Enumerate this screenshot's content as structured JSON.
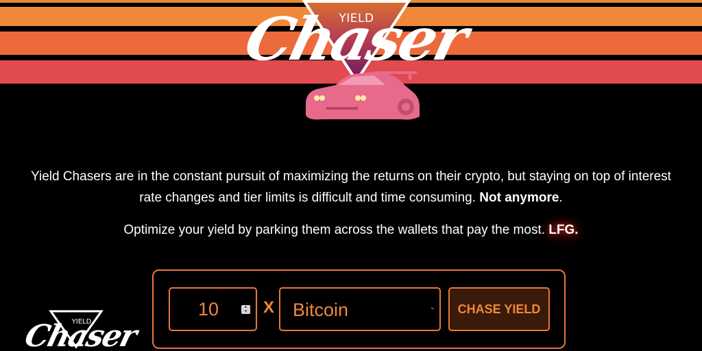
{
  "brand": {
    "logo_small_text": "YIELD",
    "logo_script_text": "Chaser",
    "colors": {
      "stripe_top": "#f0883a",
      "stripe_mid": "#ec6a3c",
      "stripe_bottom": "#e14a4e",
      "accent": "#e8793a",
      "car": "#e76a8a"
    },
    "icon": "sports-car-icon"
  },
  "intro": {
    "line1_text": "Yield Chasers are in the constant pursuit of maximizing the returns on their crypto, but staying on top of interest rate changes and tier limits is difficult and time consuming. ",
    "line1_bold": "Not anymore",
    "line1_end": ".",
    "line2_text": "Optimize your yield by parking them across the wallets that pay the most. ",
    "line2_bold": "LFG."
  },
  "form": {
    "quantity_value": "10",
    "times_symbol": "X",
    "coin_selected": "Bitcoin",
    "chase_button_label": "CHASE YIELD"
  }
}
